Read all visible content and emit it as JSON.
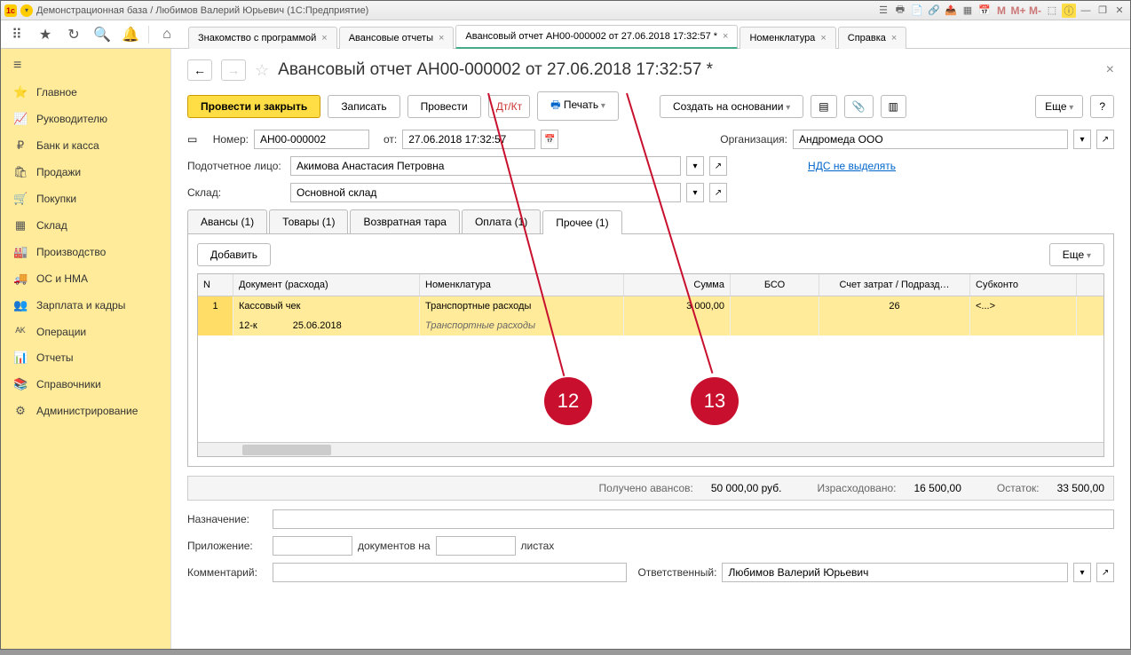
{
  "titlebar": {
    "app_icon": "1c",
    "title": "Демонстрационная база / Любимов Валерий Юрьевич  (1С:Предприятие)",
    "m1": "M",
    "m2": "M+",
    "m3": "M-"
  },
  "top_tabs": [
    {
      "label": "Знакомство с программой",
      "active": false
    },
    {
      "label": "Авансовые отчеты",
      "active": false
    },
    {
      "label": "Авансовый отчет АН00-000002 от 27.06.2018 17:32:57 *",
      "active": true
    },
    {
      "label": "Номенклатура",
      "active": false
    },
    {
      "label": "Справка",
      "active": false
    }
  ],
  "sidebar": [
    {
      "icon": "⭐",
      "label": "Главное"
    },
    {
      "icon": "📈",
      "label": "Руководителю"
    },
    {
      "icon": "₽",
      "label": "Банк и касса"
    },
    {
      "icon": "🛍",
      "label": "Продажи"
    },
    {
      "icon": "🛒",
      "label": "Покупки"
    },
    {
      "icon": "▦",
      "label": "Склад"
    },
    {
      "icon": "🏭",
      "label": "Производство"
    },
    {
      "icon": "🚚",
      "label": "ОС и НМА"
    },
    {
      "icon": "👥",
      "label": "Зарплата и кадры"
    },
    {
      "icon": "ᴬᴷ",
      "label": "Операции"
    },
    {
      "icon": "📊",
      "label": "Отчеты"
    },
    {
      "icon": "📚",
      "label": "Справочники"
    },
    {
      "icon": "⚙",
      "label": "Администрирование"
    }
  ],
  "doc": {
    "title": "Авансовый отчет АН00-000002 от 27.06.2018 17:32:57 *",
    "buttons": {
      "post_close": "Провести и закрыть",
      "save": "Записать",
      "post": "Провести",
      "print": "Печать",
      "create_based": "Создать на основании",
      "more": "Еще",
      "help": "?"
    },
    "number_label": "Номер:",
    "number": "АН00-000002",
    "date_label": "от:",
    "date": "27.06.2018 17:32:57",
    "org_label": "Организация:",
    "org": "Андромеда ООО",
    "person_label": "Подотчетное лицо:",
    "person": "Акимова Анастасия Петровна",
    "vat_link": "НДС не выделять",
    "warehouse_label": "Склад:",
    "warehouse": "Основной склад"
  },
  "inner_tabs": [
    {
      "label": "Авансы (1)"
    },
    {
      "label": "Товары (1)"
    },
    {
      "label": "Возвратная тара"
    },
    {
      "label": "Оплата (1)"
    },
    {
      "label": "Прочее (1)",
      "active": true
    }
  ],
  "table": {
    "add": "Добавить",
    "more": "Еще",
    "headers": {
      "n": "N",
      "doc": "Документ (расхода)",
      "nom": "Номенклатура",
      "sum": "Сумма",
      "bso": "БСО",
      "acc": "Счет затрат / Подразд…",
      "sub": "Субконто"
    },
    "rows": [
      {
        "n": "1",
        "doc": "Кассовый чек",
        "nom": "Транспортные расходы",
        "sum": "3 000,00",
        "bso": "",
        "acc": "26",
        "sub": "<...>"
      },
      {
        "n": "",
        "doc": "12-к",
        "doc2": "25.06.2018",
        "nom": "Транспортные расходы",
        "sum": "",
        "bso": "",
        "acc": "",
        "sub": ""
      }
    ]
  },
  "summary": {
    "advance_label": "Получено авансов:",
    "advance": "50 000,00",
    "currency": "руб.",
    "spent_label": "Израсходовано:",
    "spent": "16 500,00",
    "balance_label": "Остаток:",
    "balance": "33 500,00"
  },
  "footer": {
    "purpose_label": "Назначение:",
    "attach_label": "Приложение:",
    "docs_on": "документов на",
    "sheets": "листах",
    "comment_label": "Комментарий:",
    "responsible_label": "Ответственный:",
    "responsible": "Любимов Валерий Юрьевич"
  },
  "annotations": {
    "a12": "12",
    "a13": "13"
  }
}
